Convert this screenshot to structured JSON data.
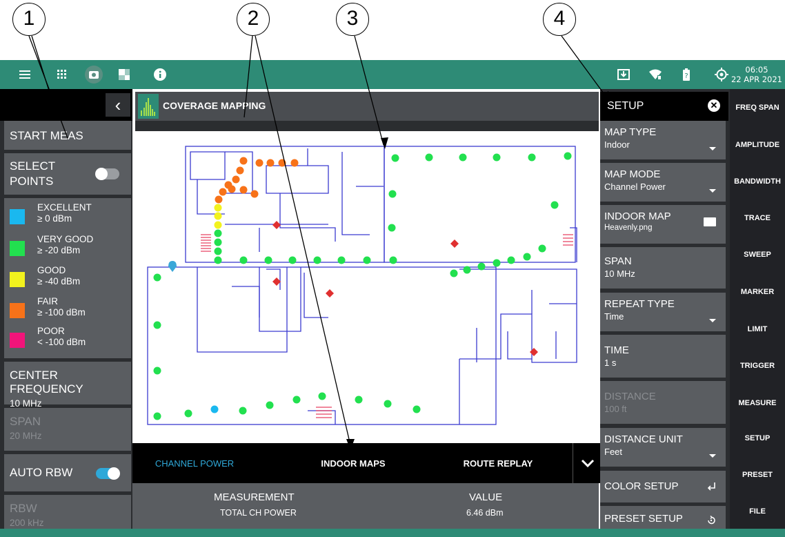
{
  "callouts": [
    "1",
    "2",
    "3",
    "4"
  ],
  "status_bar": {
    "time": "06:05",
    "date": "22 APR 2021",
    "icons": [
      "menu-icon",
      "apps-grid-icon",
      "camera-icon",
      "window-icon",
      "info-icon",
      "download-icon",
      "wifi-icon",
      "battery-icon",
      "gps-icon"
    ]
  },
  "left_panel": {
    "start_meas": "START MEAS",
    "select_points": "SELECT POINTS",
    "legend": [
      {
        "label": "EXCELLENT",
        "value": "≥ 0 dBm",
        "color": "#1ab8ef"
      },
      {
        "label": "VERY GOOD",
        "value": "≥ -20 dBm",
        "color": "#22e04f"
      },
      {
        "label": "GOOD",
        "value": "≥ -40 dBm",
        "color": "#f2f21e"
      },
      {
        "label": "FAIR",
        "value": "≥ -100 dBm",
        "color": "#f77219"
      },
      {
        "label": "POOR",
        "value": "< -100 dBm",
        "color": "#f2147a"
      }
    ],
    "center_frequency": {
      "label": "CENTER FREQUENCY",
      "value": "10 MHz"
    },
    "span": {
      "label": "SPAN",
      "value": "20 MHz"
    },
    "auto_rbw": "AUTO RBW",
    "rbw": {
      "label": "RBW",
      "value": "200 kHz"
    }
  },
  "center": {
    "title": "COVERAGE MAPPING",
    "tabs": [
      "CHANNEL POWER",
      "INDOOR MAPS",
      "ROUTE REPLAY"
    ],
    "results": {
      "measurement_header": "MEASUREMENT",
      "value_header": "VALUE",
      "measurement": "TOTAL CH POWER",
      "value": "6.46 dBm"
    }
  },
  "setup_panel": {
    "title": "SETUP",
    "items": [
      {
        "label": "MAP TYPE",
        "value": "Indoor"
      },
      {
        "label": "MAP MODE",
        "value": "Channel Power"
      },
      {
        "label": "INDOOR MAP",
        "value": "Heavenly.png"
      },
      {
        "label": "SPAN",
        "value": "10 MHz"
      },
      {
        "label": "REPEAT TYPE",
        "value": "Time"
      },
      {
        "label": "TIME",
        "value": "1 s"
      },
      {
        "label": "DISTANCE",
        "value": "100 ft"
      },
      {
        "label": "DISTANCE UNIT",
        "value": "Feet"
      },
      {
        "label": "COLOR SETUP",
        "value": ""
      },
      {
        "label": "PRESET SETUP",
        "value": ""
      }
    ]
  },
  "right_menu": [
    "FREQ SPAN",
    "AMPLITUDE",
    "BANDWIDTH",
    "TRACE",
    "SWEEP",
    "MARKER",
    "LIMIT",
    "TRIGGER",
    "MEASURE",
    "SETUP",
    "PRESET",
    "FILE"
  ],
  "colors": {
    "teal": "#2e8b76",
    "panel": "#5a5d61",
    "dark": "#2b2d30",
    "active_tab": "#2fa8d8",
    "toggle_on": "#2fa8d8"
  }
}
